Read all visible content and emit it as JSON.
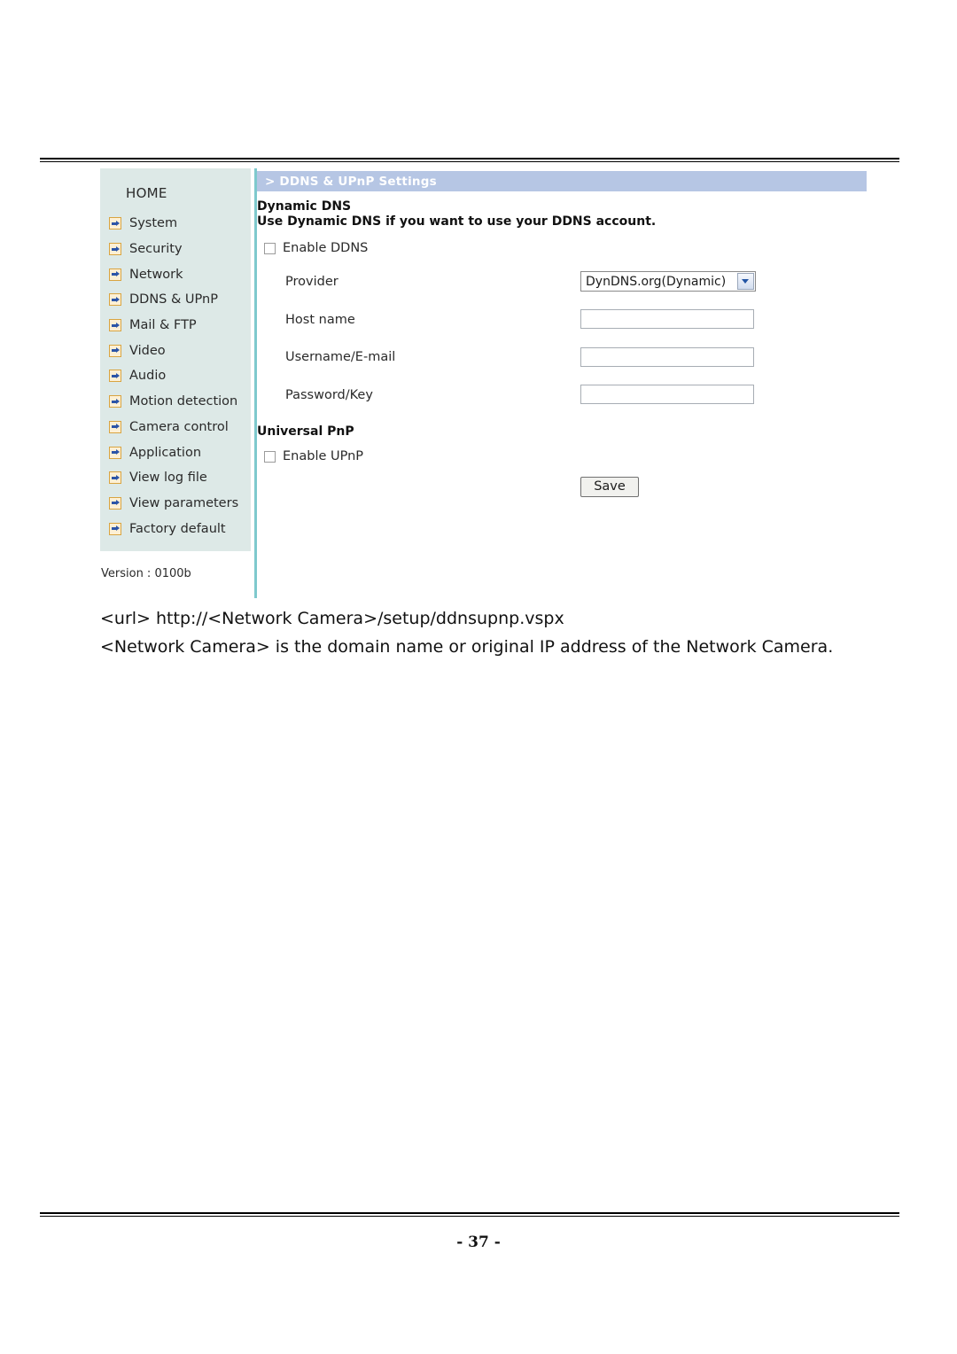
{
  "page": {
    "footer_label": "- 37 -"
  },
  "camera_ui": {
    "titlebar": {
      "text": "> DDNS & UPnP Settings"
    },
    "sidebar": {
      "home_label": "HOME",
      "version_label": "Version : 0100b",
      "items": [
        {
          "label": "System",
          "icon": "arrow-right-icon"
        },
        {
          "label": "Security",
          "icon": "arrow-right-icon"
        },
        {
          "label": "Network",
          "icon": "arrow-right-icon"
        },
        {
          "label": "DDNS & UPnP",
          "icon": "arrow-right-icon"
        },
        {
          "label": "Mail & FTP",
          "icon": "arrow-right-icon"
        },
        {
          "label": "Video",
          "icon": "arrow-right-icon"
        },
        {
          "label": "Audio",
          "icon": "arrow-right-icon"
        },
        {
          "label": "Motion detection",
          "icon": "arrow-right-icon"
        },
        {
          "label": "Camera control",
          "icon": "arrow-right-icon"
        },
        {
          "label": "Application",
          "icon": "arrow-right-icon"
        },
        {
          "label": "View log file",
          "icon": "arrow-right-icon"
        },
        {
          "label": "View parameters",
          "icon": "arrow-right-icon"
        },
        {
          "label": "Factory default",
          "icon": "arrow-right-icon"
        }
      ]
    },
    "dynamic_dns": {
      "heading": "Dynamic DNS",
      "description": "Use Dynamic DNS if you want to use your DDNS account.",
      "enable_label": "Enable DDNS",
      "enable_checked": false,
      "provider_label": "Provider",
      "provider_value": "DynDNS.org(Dynamic)",
      "host_label": "Host name",
      "host_value": "",
      "username_label": "Username/E-mail",
      "username_value": "",
      "password_label": "Password/Key",
      "password_value": ""
    },
    "universal_pnp": {
      "heading": "Universal PnP",
      "enable_label": "Enable UPnP",
      "enable_checked": false
    },
    "save_label": "Save",
    "colors": {
      "titlebar_bg": "#b6c6e4",
      "sidebar_bg": "#dde9e7",
      "sidebar_divider": "#7ec9cd",
      "nav_icon_border": "#d9a441",
      "nav_icon_arrow": "#2c55a8"
    }
  },
  "caption": {
    "line1": "<url> http://<Network Camera>/setup/ddnsupnp.vspx",
    "line2": "<Network Camera> is the domain name or original IP address of the Network Camera."
  }
}
